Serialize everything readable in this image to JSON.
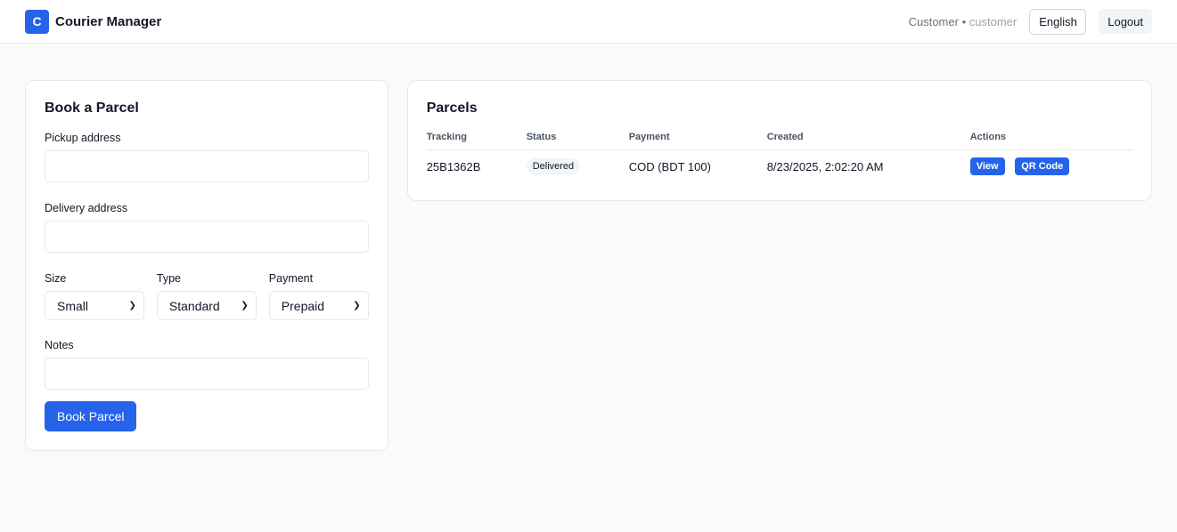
{
  "header": {
    "logo_letter": "C",
    "app_name": "Courier Manager",
    "user_name": "Customer",
    "separator": "•",
    "user_role": "customer",
    "language": "English",
    "logout_label": "Logout"
  },
  "booking": {
    "title": "Book a Parcel",
    "pickup_label": "Pickup address",
    "pickup_value": "",
    "delivery_label": "Delivery address",
    "delivery_value": "",
    "size_label": "Size",
    "size_value": "Small",
    "type_label": "Type",
    "type_value": "Standard",
    "payment_label": "Payment",
    "payment_value": "Prepaid",
    "notes_label": "Notes",
    "notes_value": "",
    "submit_label": "Book Parcel"
  },
  "parcels": {
    "title": "Parcels",
    "columns": [
      "Tracking",
      "Status",
      "Payment",
      "Created",
      "Actions"
    ],
    "rows": [
      {
        "tracking": "25B1362B",
        "status": "Delivered",
        "payment": "COD (BDT 100)",
        "created": "8/23/2025, 2:02:20 AM",
        "view_label": "View",
        "qr_label": "QR Code"
      }
    ]
  },
  "colors": {
    "accent": "#2563eb",
    "background": "#f8fafc",
    "card": "#ffffff",
    "border": "#e5e7eb"
  }
}
